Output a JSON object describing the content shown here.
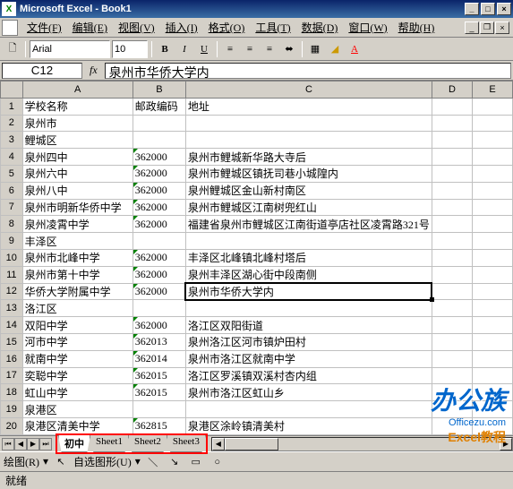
{
  "title": "Microsoft Excel - Book1",
  "menu": [
    "文件(F)",
    "编辑(E)",
    "视图(V)",
    "插入(I)",
    "格式(O)",
    "工具(T)",
    "数据(D)",
    "窗口(W)",
    "帮助(H)"
  ],
  "font": {
    "name": "Arial",
    "size": "10"
  },
  "namebox": "C12",
  "fx": "fx",
  "formula": "泉州市华侨大学内",
  "columns": [
    "A",
    "B",
    "C",
    "D",
    "E"
  ],
  "rows": [
    {
      "n": 1,
      "a": "学校名称",
      "b": "邮政编码",
      "c": "地址"
    },
    {
      "n": 2,
      "a": "泉州市"
    },
    {
      "n": 3,
      "a": "鲤城区"
    },
    {
      "n": 4,
      "a": "泉州四中",
      "b": "362000",
      "c": "泉州市鲤城新华路大寺后",
      "tri": true
    },
    {
      "n": 5,
      "a": "泉州六中",
      "b": "362000",
      "c": "泉州市鲤城区镇抚司巷小城隍内",
      "tri": true
    },
    {
      "n": 6,
      "a": "泉州八中",
      "b": "362000",
      "c": "泉州鲤城区金山新村南区",
      "tri": true
    },
    {
      "n": 7,
      "a": "泉州市明新华侨中学",
      "b": "362000",
      "c": "泉州市鲤城区江南树兜红山",
      "tri": true
    },
    {
      "n": 8,
      "a": "泉州凌霄中学",
      "b": "362000",
      "c": "福建省泉州市鲤城区江南街道亭店社区凌霄路321号",
      "tri": true
    },
    {
      "n": 9,
      "a": "丰泽区"
    },
    {
      "n": 10,
      "a": "泉州市北峰中学",
      "b": "362000",
      "c": "丰泽区北峰镇北峰村塔后",
      "tri": true
    },
    {
      "n": 11,
      "a": "泉州市第十中学",
      "b": "362000",
      "c": "泉州丰泽区湖心街中段南侧",
      "tri": true
    },
    {
      "n": 12,
      "a": "华侨大学附属中学",
      "b": "362000",
      "c": "泉州市华侨大学内",
      "tri": true,
      "sel": true
    },
    {
      "n": 13,
      "a": "洛江区"
    },
    {
      "n": 14,
      "a": "双阳中学",
      "b": "362000",
      "c": "洛江区双阳街道",
      "tri": true
    },
    {
      "n": 15,
      "a": "河市中学",
      "b": "362013",
      "c": "泉州洛江区河市镇炉田村",
      "tri": true
    },
    {
      "n": 16,
      "a": "就南中学",
      "b": "362014",
      "c": "泉州市洛江区就南中学",
      "tri": true
    },
    {
      "n": 17,
      "a": "奕聪中学",
      "b": "362015",
      "c": "洛江区罗溪镇双溪村杏内组",
      "tri": true
    },
    {
      "n": 18,
      "a": "虹山中学",
      "b": "362015",
      "c": "泉州市洛江区虹山乡",
      "tri": true
    },
    {
      "n": 19,
      "a": "泉港区"
    },
    {
      "n": 20,
      "a": "泉港区清美中学",
      "b": "362815",
      "c": "泉港区涂岭镇清美村",
      "tri": true
    }
  ],
  "tabs": {
    "active": "初中",
    "list": [
      "初中",
      "Sheet1",
      "Sheet2",
      "Sheet3"
    ]
  },
  "draw": {
    "label": "绘图(R)",
    "auto": "自选图形(U)"
  },
  "status": "就绪",
  "watermark": {
    "big": "办公族",
    "url": "Officezu.com",
    "sub": "Excel教程"
  }
}
